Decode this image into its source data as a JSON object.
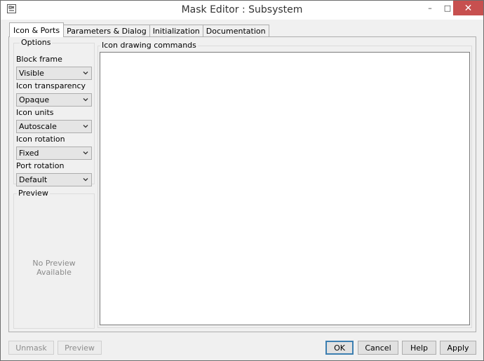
{
  "window": {
    "title": "Mask Editor : Subsystem",
    "minimize_symbol": "–",
    "maximize_symbol": "□",
    "close_symbol": "✕"
  },
  "tabs": [
    {
      "label": "Icon & Ports",
      "active": true
    },
    {
      "label": "Parameters & Dialog"
    },
    {
      "label": "Initialization"
    },
    {
      "label": "Documentation"
    }
  ],
  "options": {
    "title": "Options",
    "items": [
      {
        "label": "Block frame",
        "value": "Visible"
      },
      {
        "label": "Icon transparency",
        "value": "Opaque"
      },
      {
        "label": "Icon units",
        "value": "Autoscale"
      },
      {
        "label": "Icon rotation",
        "value": "Fixed"
      },
      {
        "label": "Port rotation",
        "value": "Default"
      }
    ]
  },
  "preview": {
    "title": "Preview",
    "message": "No Preview Available"
  },
  "drawing": {
    "title": "Icon drawing commands",
    "value": ""
  },
  "buttons": {
    "unmask": "Unmask",
    "preview": "Preview",
    "ok": "OK",
    "cancel": "Cancel",
    "help": "Help",
    "apply": "Apply"
  },
  "colors": {
    "close_button": "#c7504f",
    "default_button_border": "#3c7fb1"
  }
}
